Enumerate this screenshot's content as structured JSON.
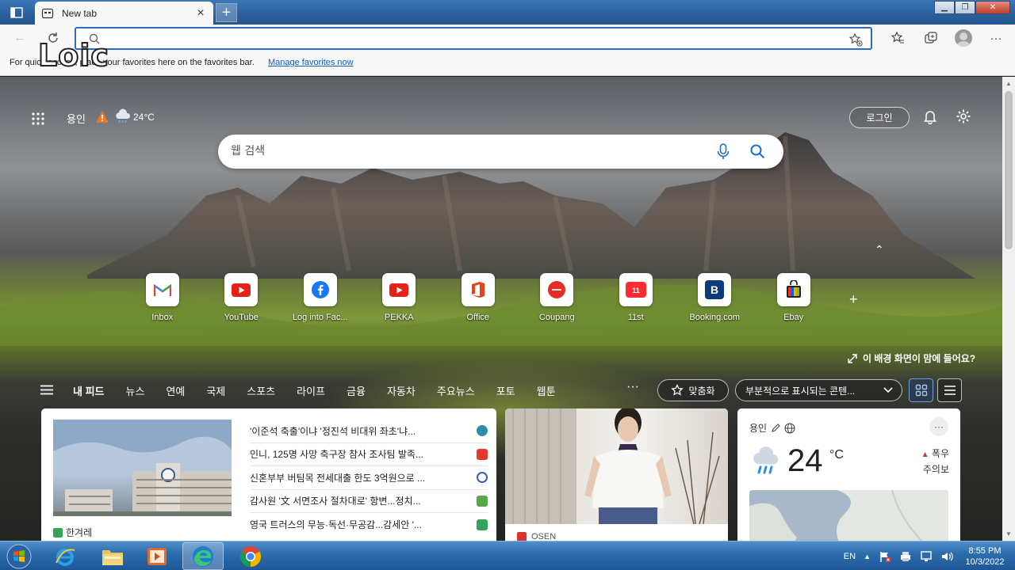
{
  "browser": {
    "tab_title": "New tab",
    "new_tab_symbol": "+",
    "address_value": "",
    "favorites_bar_text": "For quick access, place your favorites here on the favorites bar.",
    "manage_favorites_link": "Manage favorites now",
    "watermark": "Loic"
  },
  "newtab": {
    "location": "용인",
    "temperature": "24°C",
    "login_label": "로그인",
    "search_placeholder": "웹 검색",
    "background_feedback": "이 배경 화면이 맘에 들어요?",
    "quick_links": [
      {
        "label": "Inbox",
        "icon": "gmail-icon"
      },
      {
        "label": "YouTube",
        "icon": "youtube-icon"
      },
      {
        "label": "Log into Fac...",
        "icon": "facebook-icon"
      },
      {
        "label": "PEKKA",
        "icon": "youtube-icon"
      },
      {
        "label": "Office",
        "icon": "office-icon"
      },
      {
        "label": "Coupang",
        "icon": "coupang-icon"
      },
      {
        "label": "11st",
        "icon": "11st-icon"
      },
      {
        "label": "Booking.com",
        "icon": "booking-icon"
      },
      {
        "label": "Ebay",
        "icon": "ebay-icon"
      }
    ]
  },
  "feed": {
    "tabs": [
      "내 피드",
      "뉴스",
      "연예",
      "국제",
      "스포츠",
      "라이프",
      "금융",
      "자동차",
      "주요뉴스",
      "포토",
      "웹툰"
    ],
    "more": "···",
    "personalize_label": "맞춤화",
    "content_select": "부분적으로 표시되는 콘텐..."
  },
  "news_card": {
    "source": "한겨레",
    "headlines": [
      "'이준석 축출'이냐 '정진석 비대위 좌초'냐...",
      "인니, 125명 사망 축구장 참사 조사팀 발족...",
      "신혼부부 버팀목 전세대출 한도 3억원으로 ...",
      "감사원 '文 서면조사 절차대로' 항변...정치...",
      "영국 트러스의 무능·독선·무공감...감세안 '..."
    ]
  },
  "video_card": {
    "source": "OSEN"
  },
  "weather_card": {
    "location": "용인",
    "temperature": "24",
    "unit": "°C",
    "alert_line1": "폭우",
    "alert_line2": "주의보"
  },
  "taskbar": {
    "language": "EN",
    "time": "8:55 PM",
    "date": "10/3/2022"
  },
  "colors": {
    "accent": "#2d6bc4",
    "taskbar": "#2f6eae"
  }
}
